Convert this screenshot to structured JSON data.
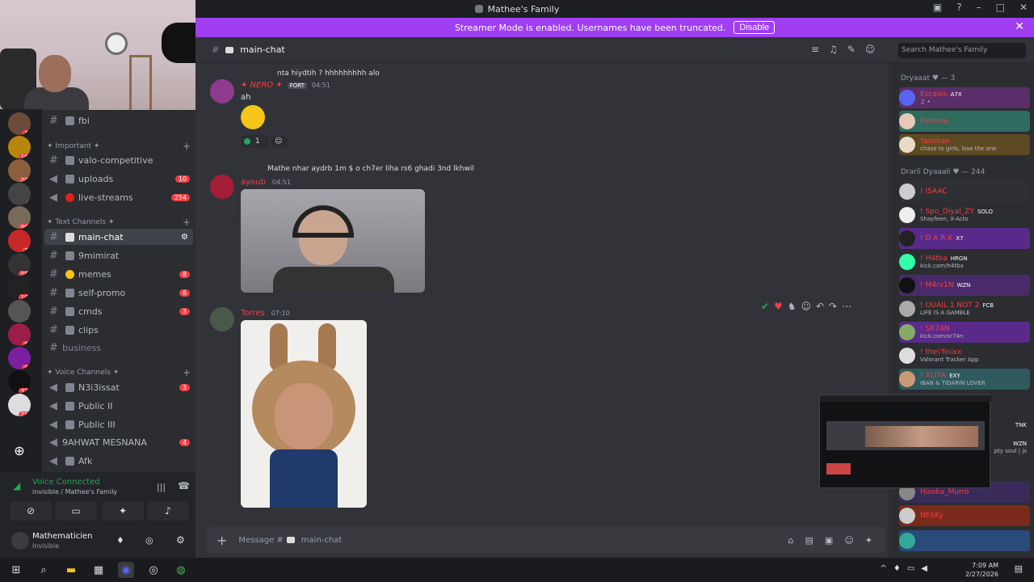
{
  "window": {
    "title": "Mathee's Family"
  },
  "banner": {
    "text": "Streamer Mode is enabled. Usernames have been truncated.",
    "button": "Disable"
  },
  "servers": [
    {
      "badge": "10"
    },
    {
      "badge": "164"
    },
    {
      "badge": "202"
    },
    {
      "badge": "4"
    },
    {
      "badge": "900"
    },
    {
      "badge": "72"
    },
    {
      "badge": "583"
    },
    {
      "badge": "181"
    },
    {
      "badge": "3"
    },
    {
      "badge": "55"
    },
    {
      "badge": "88"
    },
    {
      "badge": "336"
    },
    {
      "badge": "287"
    }
  ],
  "channels": {
    "fbi": "fbi",
    "cat_important": "✦ Important ✦",
    "valo": "valo-competitive",
    "uploads": "uploads",
    "uploads_count": "10",
    "live": "live-streams",
    "live_count": "254",
    "cat_text": "✦ Text Channels ✦",
    "main": "main-chat",
    "nmirat": "9mimirat",
    "memes": "memes",
    "memes_count": "8",
    "selfpromo": "self-promo",
    "selfpromo_count": "6",
    "cmds": "cmds",
    "cmds_count": "3",
    "clips": "clips",
    "business": "business",
    "cat_voice": "✦ Voice Channels ✦",
    "n3i": "N3i3issat",
    "n3i_count": "3",
    "pub2": "Public II",
    "pub3": "Public III",
    "ahwat": "9AHWAT MESNANA",
    "ahwat_count": "4",
    "afk": "Afk"
  },
  "voice": {
    "title": "Voice Connected",
    "sub": "invisible / Mathee's Family"
  },
  "user": {
    "name": "Mathematicien",
    "status": "Invisible"
  },
  "header": {
    "channel": "main-chat",
    "search": "Search Mathee's Family"
  },
  "messages": {
    "m1_reply": "nta hiydtih ? hhhhhhhhh alo",
    "m1_author": "✦ NERO ✦",
    "m1_tag": "FORT",
    "m1_time": "04:51",
    "m1_text": "ah",
    "m1_react": "1",
    "m2_reply": "Mathe nhar aydrb 1m $ o ch7er liha rs6 ghadi 3nd lkhwil",
    "m2_author": "ayoub",
    "m2_time": "04:51",
    "m3_author": "Torres",
    "m3_time": "07:10"
  },
  "composer": {
    "placeholder": "Message #",
    "channel": "main-chat"
  },
  "members": {
    "g1": "Dryaaat ♥ — 3",
    "g2": "Drarli Dyaaali ♥ — 244",
    "list": [
      {
        "name": "Escales",
        "act": "♫ •",
        "tag": "A7X"
      },
      {
        "name": "Petrova",
        "act": "",
        "tag": ""
      },
      {
        "name": "Yaseban",
        "act": "chase to girls, lose the one",
        "tag": ""
      },
      {
        "name": "! ISAAC",
        "act": "",
        "tag": ""
      },
      {
        "name": "! Spo_Diyal_ZY",
        "act": "Shayfeen, X-Acto",
        "tag": "SOLO"
      },
      {
        "name": "! D A R K",
        "act": "",
        "tag": "X7"
      },
      {
        "name": "! H4tba",
        "act": "kick.com/h4tba",
        "tag": "HRGN"
      },
      {
        "name": "! M4rv1N",
        "act": "",
        "tag": "WZN"
      },
      {
        "name": "! OUAIL 1 NOT 2",
        "act": "LIFE IS A GAMBLE",
        "tag": "FCB"
      },
      {
        "name": "! SR74N",
        "act": "kick.com/sr74n",
        "tag": ""
      },
      {
        "name": "! the\\'finixx",
        "act": "Valorant Tracker App",
        "tag": ""
      },
      {
        "name": "! XLI7A",
        "act": "IBAN & TIDARIN LOVER",
        "tag": "EXY"
      },
      {
        "name": "",
        "act": "",
        "tag": "TNK"
      },
      {
        "name": "",
        "act": "pty soul | js",
        "tag": "WZN"
      },
      {
        "name": "Hiseka_Murro",
        "act": "",
        "tag": ""
      },
      {
        "name": "NE6Ky",
        "act": "",
        "tag": ""
      }
    ]
  },
  "clock": {
    "time": "7:09 AM",
    "date": "2/27/2026"
  }
}
